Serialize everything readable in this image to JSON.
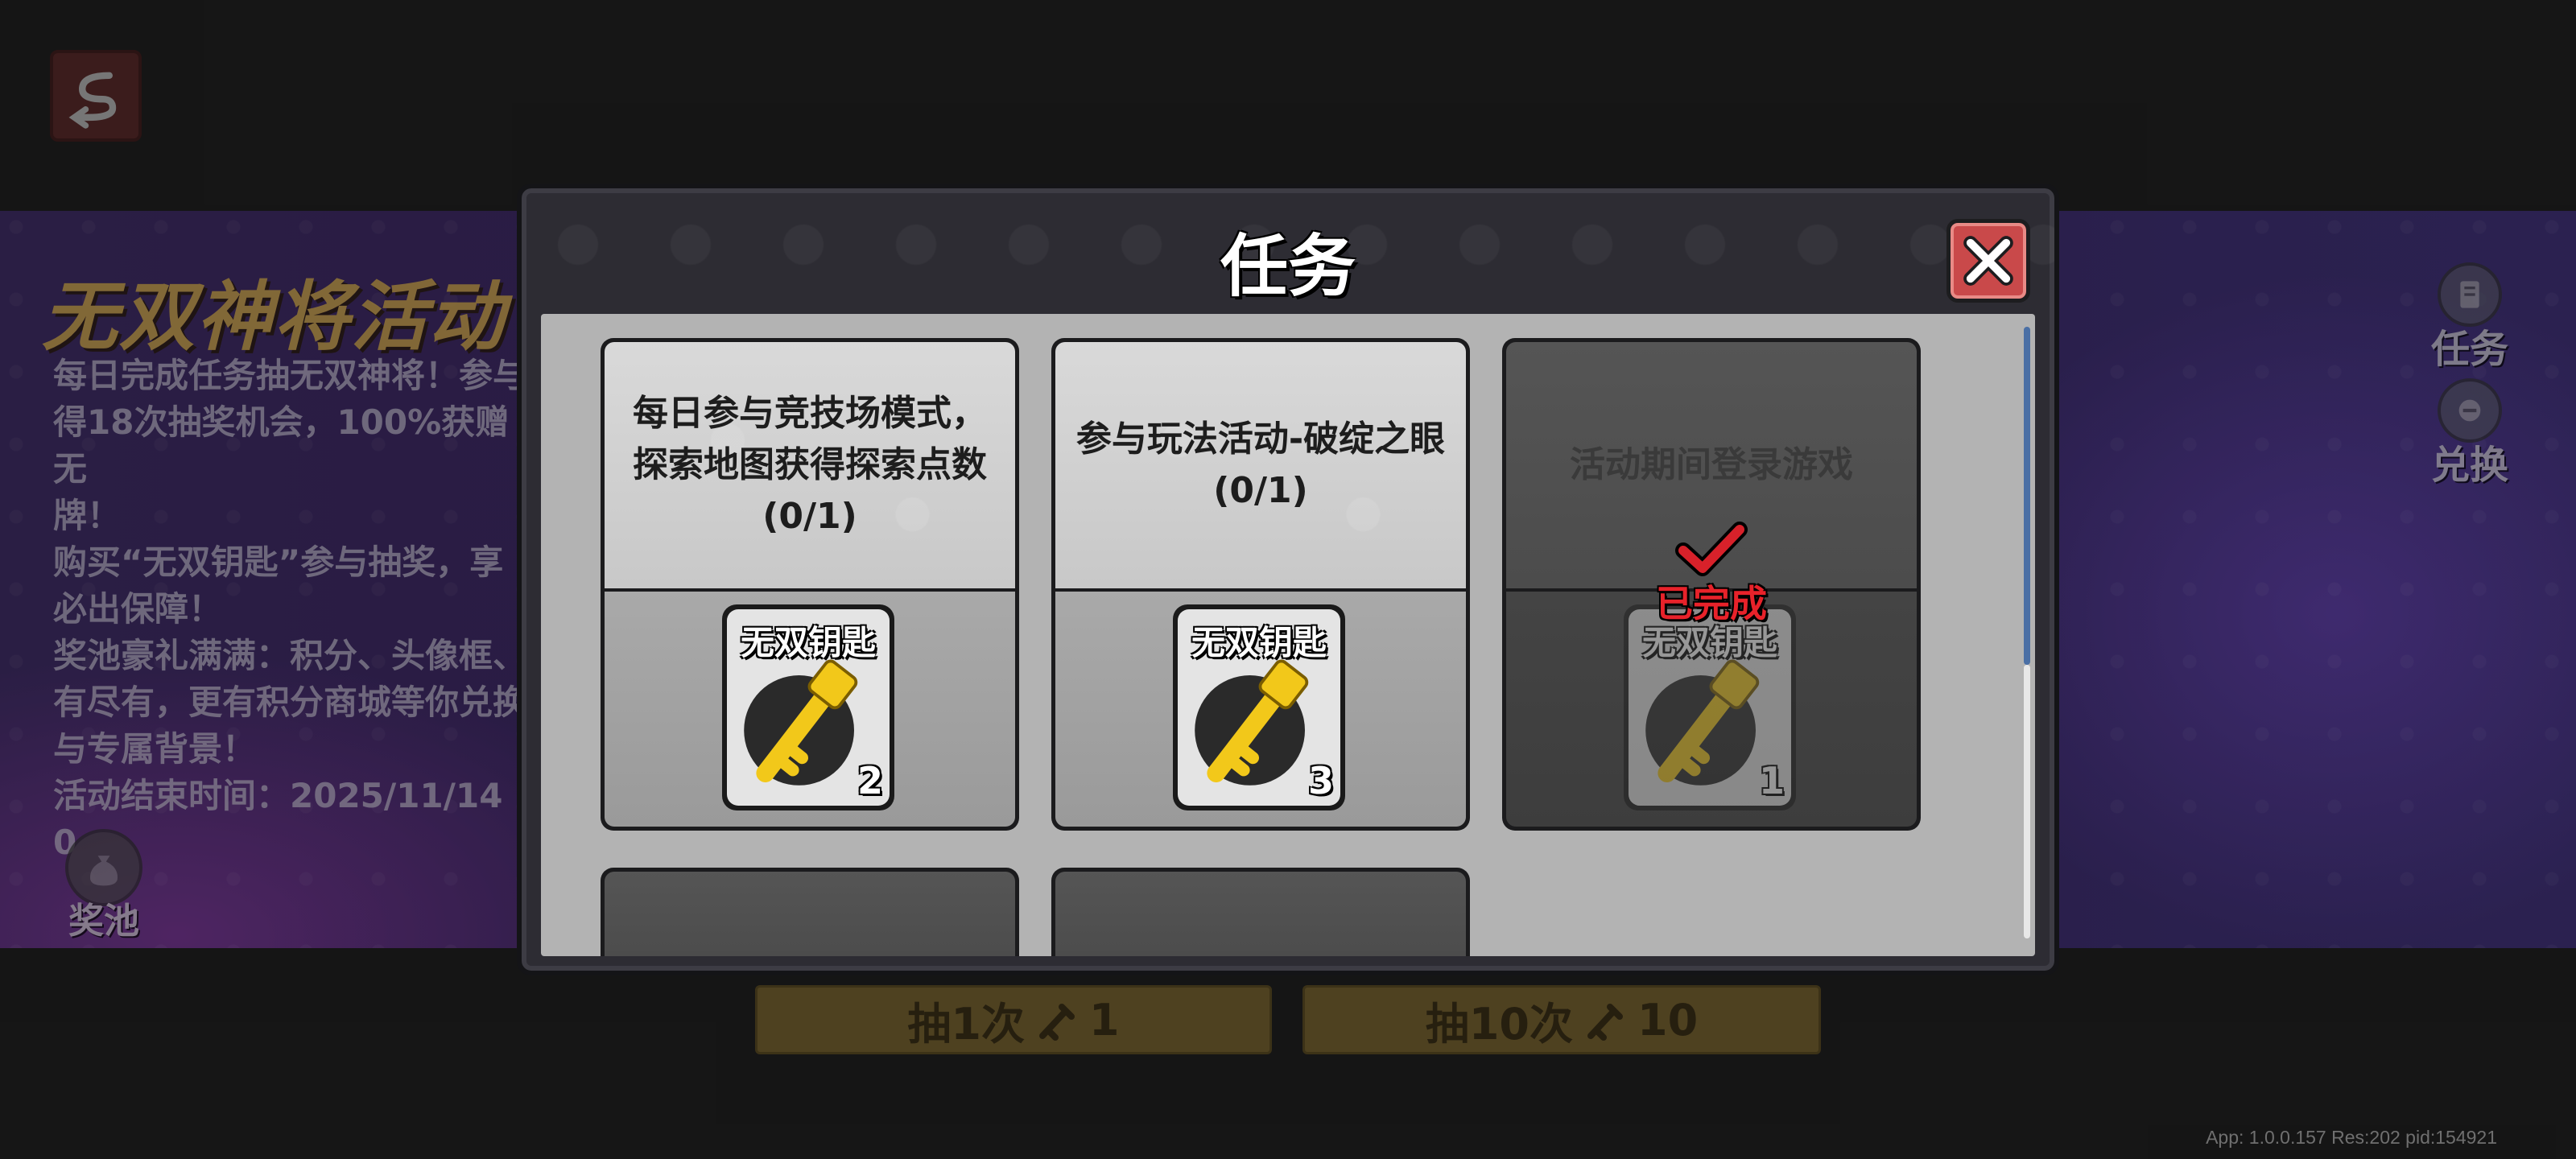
{
  "background": {
    "event_title": "无双神将活动",
    "event_description": "每日完成任务抽无双神将！参与\n得18次抽奖机会，100%获赠无\n牌！\n购买“无双钥匙”参与抽奖，享\n必出保障！\n奖池豪礼满满：积分、头像框、\n有尽有，更有积分商城等你兑换\n与专属背景！\n活动结束时间：2025/11/14 0",
    "prize_pool_label": "奖池",
    "side_tasks_label": "任务",
    "side_exchange_label": "兑换",
    "draw_once": {
      "label": "抽1次",
      "cost": "1"
    },
    "draw_ten": {
      "label": "抽10次",
      "cost": "10"
    },
    "version_info": "App: 1.0.0.157 Res:202 pid:154921"
  },
  "dialog": {
    "title": "任务",
    "tasks": [
      {
        "description": "每日参与竞技场模式，探索地图获得探索点数(0/1)",
        "reward_name": "无双钥匙",
        "reward_count": "2",
        "completed": false
      },
      {
        "description": "参与玩法活动-破绽之眼(0/1)",
        "reward_name": "无双钥匙",
        "reward_count": "3",
        "completed": false
      },
      {
        "description": "活动期间登录游戏",
        "reward_name": "无双钥匙",
        "reward_count": "1",
        "completed": true,
        "status_label": "已完成"
      }
    ]
  },
  "colors": {
    "accent_close": "#c9494a",
    "done_red": "#e8222a",
    "draw_button": "#7a6530",
    "key_gold": "#f2c81a"
  }
}
